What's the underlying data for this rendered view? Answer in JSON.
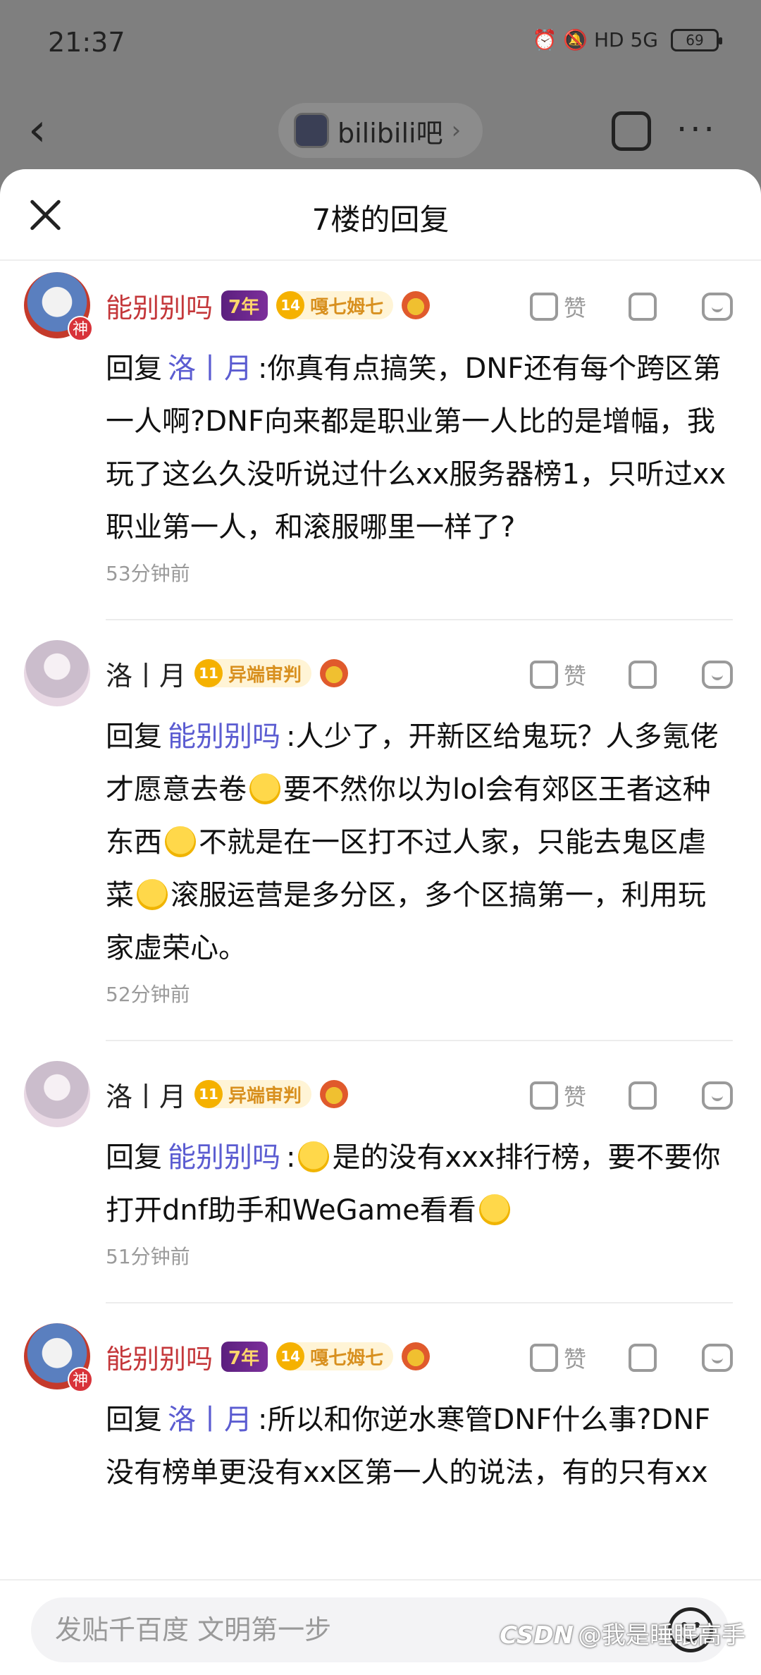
{
  "status": {
    "time": "21:37",
    "icons": "⏰ 🔕 HD 5G",
    "battery": "69"
  },
  "nav": {
    "back": "‹",
    "forum_name": "bilibili吧",
    "forum_chevron": "›",
    "more": "···"
  },
  "sheet": {
    "title": "7楼的回复"
  },
  "labels": {
    "like": "赞",
    "reply_prefix": "回复"
  },
  "replies": [
    {
      "user": "能别别吗",
      "year_badge": "7年",
      "level": "14",
      "level_name": "嘎七姆七",
      "god_badge": "神",
      "mention": "洛丨月",
      "text": ":你真有点搞笑，DNF还有每个跨区第一人啊?DNF向来都是职业第一人比的是增幅，我玩了这么久没听说过什么xx服务器榜1，只听过xx职业第一人，和滚服哪里一样了?",
      "time": "53分钟前"
    },
    {
      "user": "洛丨月",
      "level": "11",
      "level_name": "异端审判",
      "mention": "能别别吗",
      "text_1": ":人少了，开新区给鬼玩？人多氪佬才愿意去卷",
      "text_2": "要不然你以为lol会有郊区王者这种东西",
      "text_3": "不就是在一区打不过人家，只能去鬼区虐菜",
      "text_4": "滚服运营是多分区，多个区搞第一，利用玩家虚荣心。",
      "time": "52分钟前"
    },
    {
      "user": "洛丨月",
      "level": "11",
      "level_name": "异端审判",
      "mention": "能别别吗",
      "text_1": ":",
      "text_2": "是的没有xxx排行榜，要不要你打开dnf助手和WeGame看看",
      "time": "51分钟前"
    },
    {
      "user": "能别别吗",
      "year_badge": "7年",
      "level": "14",
      "level_name": "嘎七姆七",
      "god_badge": "神",
      "mention": "洛丨月",
      "text": ":所以和你逆水寒管DNF什么事?DNF没有榜单更没有xx区第一人的说法，有的只有xx"
    }
  ],
  "composer": {
    "placeholder": "发贴千百度 文明第一步"
  },
  "watermark": {
    "logo": "CSDN",
    "text": "@我是睡眠高手"
  }
}
